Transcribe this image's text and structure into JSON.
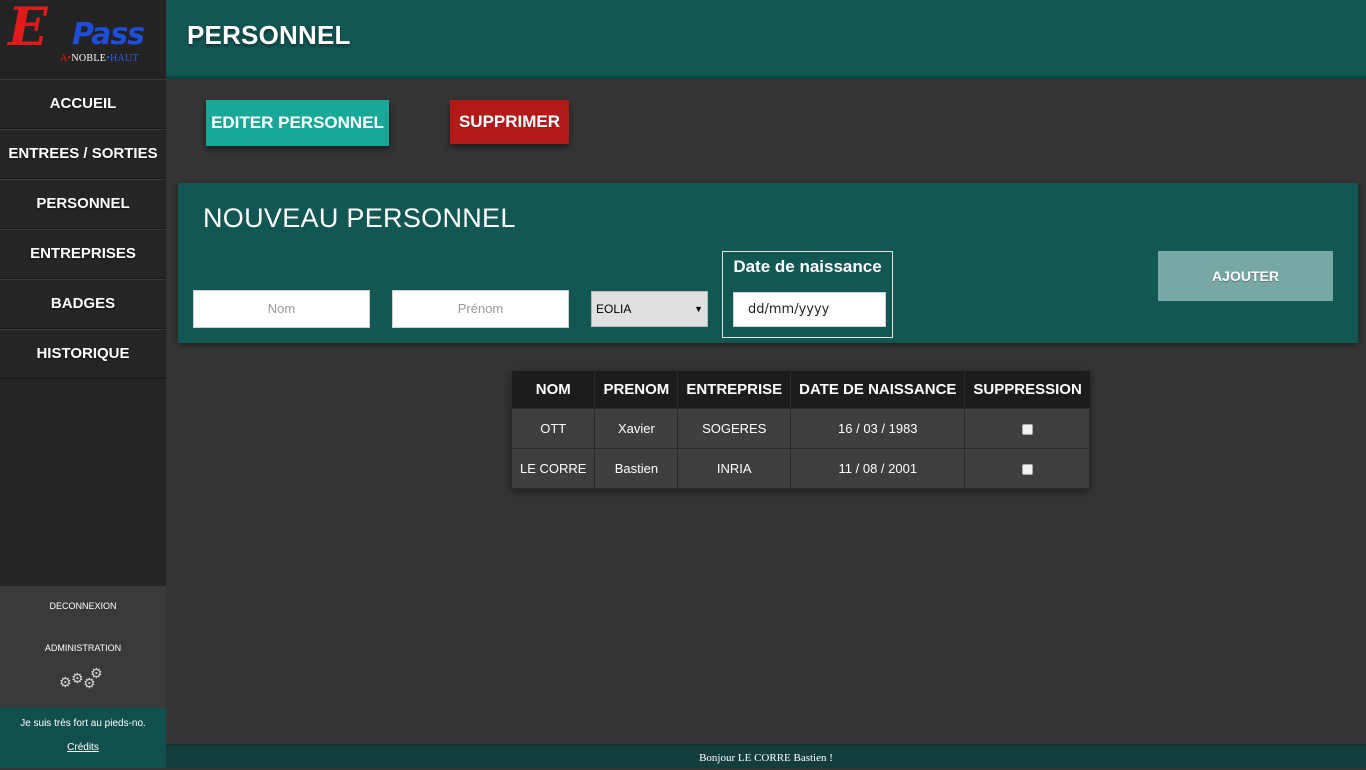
{
  "logo": {
    "letter": "E",
    "rest": "Pass",
    "motto_a": "A",
    "motto_noble": "NOBLE",
    "motto_haut": "HAUT",
    "motto_dot": "•"
  },
  "sidebar": {
    "items": [
      {
        "label": "ACCUEIL"
      },
      {
        "label": "ENTREES / SORTIES"
      },
      {
        "label": "PERSONNEL"
      },
      {
        "label": "ENTREPRISES"
      },
      {
        "label": "BADGES"
      },
      {
        "label": "HISTORIQUE"
      }
    ],
    "logout": "DECONNEXION",
    "admin": "ADMINISTRATION",
    "admin_icon": "gears-icon",
    "quote": "Je suis très fort au pieds-no.",
    "credits": "Crédits"
  },
  "header": {
    "title": "PERSONNEL"
  },
  "actions": {
    "edit": "EDITER PERSONNEL",
    "delete": "SUPPRIMER"
  },
  "form": {
    "title": "NOUVEAU PERSONNEL",
    "nom_placeholder": "Nom",
    "prenom_placeholder": "Prénom",
    "company_selected": "EOLIA",
    "date_label": "Date de naissance",
    "date_placeholder": "dd/mm/yyyy",
    "add": "AJOUTER"
  },
  "table": {
    "headers": [
      "NOM",
      "PRENOM",
      "ENTREPRISE",
      "DATE DE NAISSANCE",
      "SUPPRESSION"
    ],
    "rows": [
      {
        "nom": "OTT",
        "prenom": "Xavier",
        "entreprise": "SOGERES",
        "date": "16 / 03 / 1983",
        "checked": false
      },
      {
        "nom": "LE CORRE",
        "prenom": "Bastien",
        "entreprise": "INRIA",
        "date": "11 / 08 / 2001",
        "checked": false
      }
    ]
  },
  "footer": {
    "greeting": "Bonjour LE CORRE Bastien !"
  },
  "colors": {
    "teal_dark": "#135755",
    "teal_button": "#17a897",
    "red_button": "#b21919",
    "add_button": "#78a8a6",
    "background": "#353535"
  }
}
